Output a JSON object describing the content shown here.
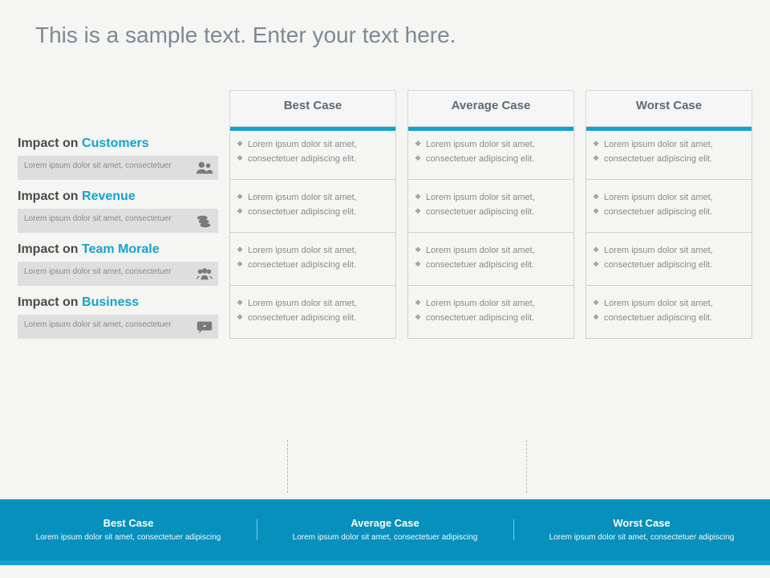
{
  "title": "This is a sample text. Enter your text here.",
  "columns": [
    "Best Case",
    "Average Case",
    "Worst Case"
  ],
  "rows": [
    {
      "label_prefix": "Impact on ",
      "label_highlight": "Customers",
      "sub": "Lorem ipsum dolor sit amet, consectetuer",
      "icon": "people-icon",
      "cells": [
        [
          "Lorem ipsum dolor sit amet,",
          "consectetuer adipiscing elit."
        ],
        [
          "Lorem ipsum dolor sit amet,",
          "consectetuer adipiscing elit."
        ],
        [
          "Lorem ipsum dolor sit amet,",
          "consectetuer adipiscing elit."
        ]
      ]
    },
    {
      "label_prefix": "Impact on ",
      "label_highlight": "Revenue",
      "sub": "Lorem ipsum dolor sit amet, consectetuer",
      "icon": "coins-icon",
      "cells": [
        [
          "Lorem ipsum dolor sit amet,",
          "consectetuer adipiscing elit."
        ],
        [
          "Lorem ipsum dolor sit amet,",
          "consectetuer adipiscing elit."
        ],
        [
          "Lorem ipsum dolor sit amet,",
          "consectetuer adipiscing elit."
        ]
      ]
    },
    {
      "label_prefix": "Impact on ",
      "label_highlight": "Team Morale",
      "sub": "Lorem ipsum dolor sit amet, consectetuer",
      "icon": "group-icon",
      "cells": [
        [
          "Lorem ipsum dolor sit amet,",
          "consectetuer adipiscing elit."
        ],
        [
          "Lorem ipsum dolor sit amet,",
          "consectetuer adipiscing elit."
        ],
        [
          "Lorem ipsum dolor sit amet,",
          "consectetuer adipiscing elit."
        ]
      ]
    },
    {
      "label_prefix": "Impact on ",
      "label_highlight": "Business",
      "sub": "Lorem ipsum dolor sit amet, consectetuer",
      "icon": "comment-icon",
      "cells": [
        [
          "Lorem ipsum dolor sit amet,",
          "consectetuer adipiscing elit."
        ],
        [
          "Lorem ipsum dolor sit amet,",
          "consectetuer adipiscing elit."
        ],
        [
          "Lorem ipsum dolor sit amet,",
          "consectetuer adipiscing elit."
        ]
      ]
    }
  ],
  "footer": [
    {
      "title": "Best Case",
      "text": "Lorem ipsum dolor sit amet, consectetuer adipiscing"
    },
    {
      "title": "Average Case",
      "text": "Lorem ipsum dolor sit amet, consectetuer adipiscing"
    },
    {
      "title": "Worst Case",
      "text": "Lorem ipsum dolor sit amet, consectetuer adipiscing"
    }
  ]
}
